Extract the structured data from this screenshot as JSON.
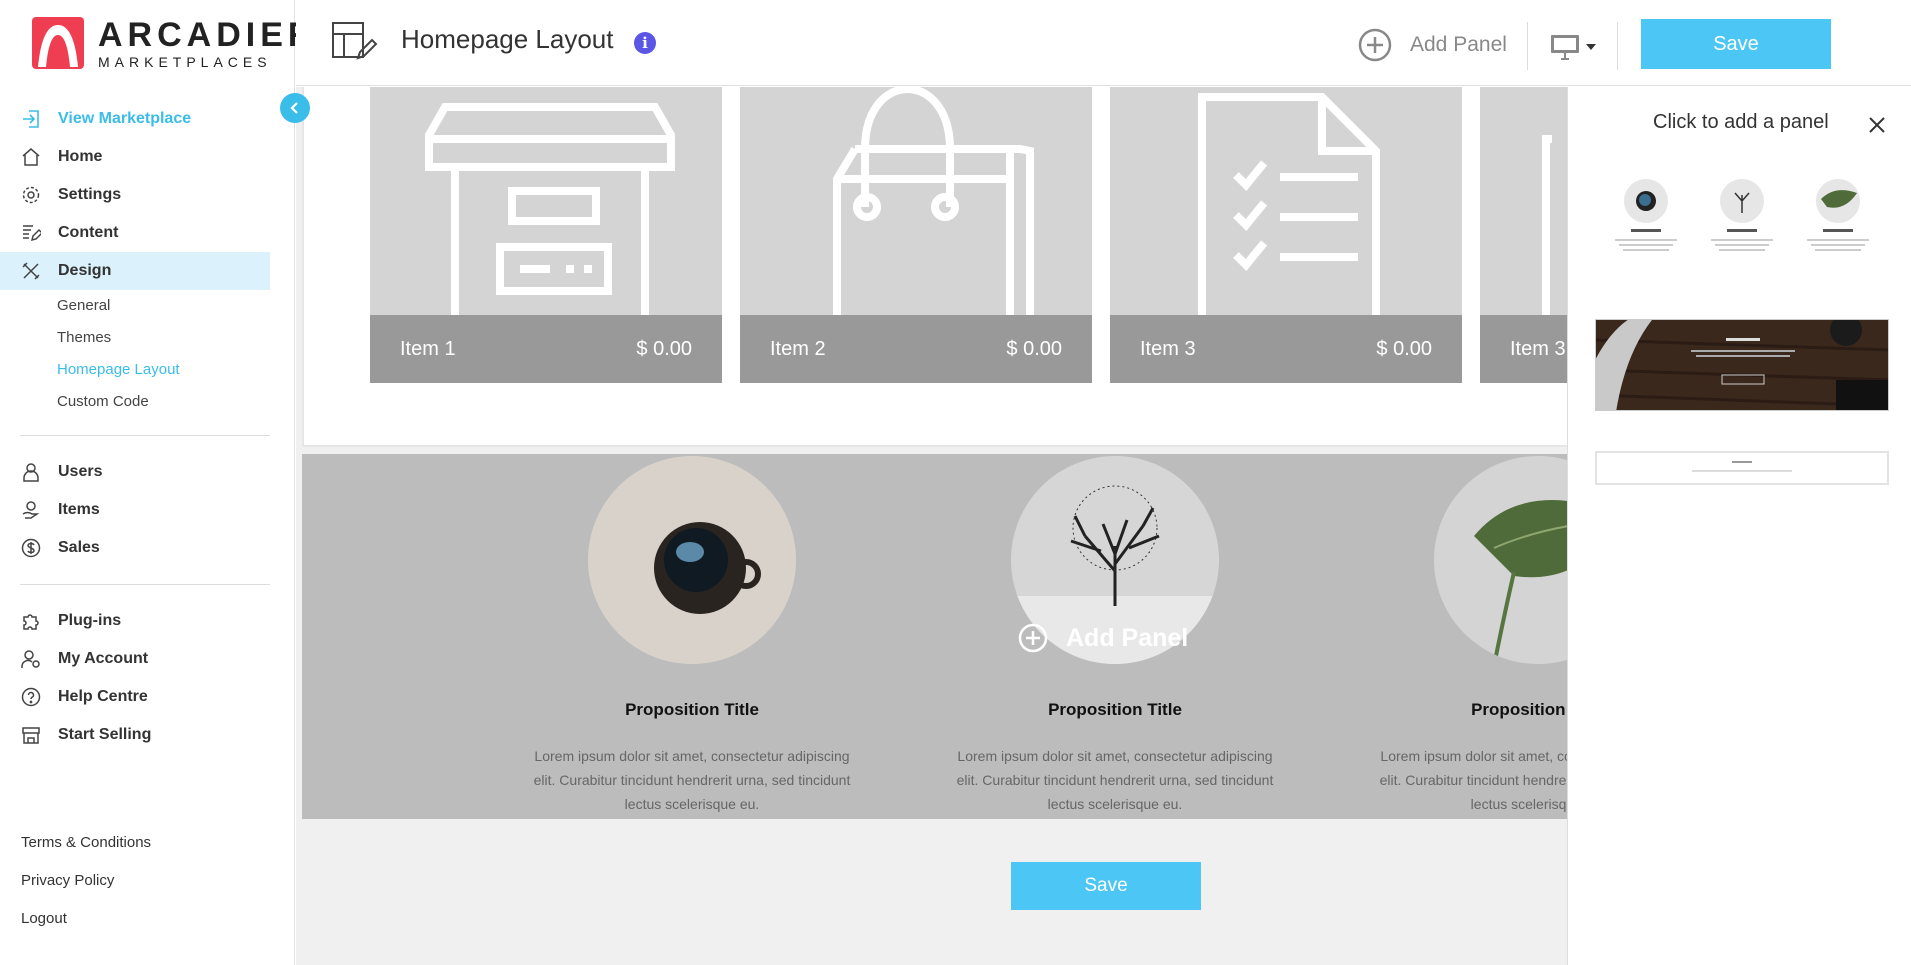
{
  "brand": {
    "line1": "ARCADIER",
    "line2": "MARKETPLACES",
    "color": "#ef3e52"
  },
  "colors": {
    "accent": "#3bbde9",
    "save": "#4cc6f5",
    "info": "#5b56e5"
  },
  "sidebar": {
    "view_marketplace": "View Marketplace",
    "items": [
      {
        "label": "Home",
        "icon": "home-icon"
      },
      {
        "label": "Settings",
        "icon": "gear-icon"
      },
      {
        "label": "Content",
        "icon": "content-edit-icon"
      },
      {
        "label": "Design",
        "icon": "design-tools-icon"
      }
    ],
    "design_sub": [
      "General",
      "Themes",
      "Homepage Layout",
      "Custom Code"
    ],
    "group2": [
      {
        "label": "Users",
        "icon": "user-icon"
      },
      {
        "label": "Items",
        "icon": "items-hand-icon"
      },
      {
        "label": "Sales",
        "icon": "dollar-icon"
      }
    ],
    "group3": [
      {
        "label": "Plug-ins",
        "icon": "puzzle-icon"
      },
      {
        "label": "My Account",
        "icon": "account-gear-icon"
      },
      {
        "label": "Help Centre",
        "icon": "help-icon"
      },
      {
        "label": "Start Selling",
        "icon": "storefront-icon"
      }
    ],
    "footer": [
      "Terms & Conditions",
      "Privacy Policy",
      "Logout"
    ]
  },
  "header": {
    "title": "Homepage Layout",
    "info_glyph": "i",
    "add_panel": "Add Panel",
    "save": "Save"
  },
  "canvas": {
    "items": [
      {
        "name": "Item 1",
        "price": "$ 0.00",
        "icon": "archive-box-icon"
      },
      {
        "name": "Item 2",
        "price": "$ 0.00",
        "icon": "shopping-bag-icon"
      },
      {
        "name": "Item 3",
        "price": "$ 0.00",
        "icon": "checklist-document-icon"
      },
      {
        "name": "Item 3",
        "price": "",
        "icon": "document-icon"
      }
    ],
    "propositions": [
      {
        "title": "Proposition Title",
        "text": "Lorem ipsum dolor sit amet, consectetur adipiscing elit. Curabitur tincidunt hendrerit urna, sed tincidunt lectus scelerisque eu.",
        "image": "coffee-cup"
      },
      {
        "title": "Proposition Title",
        "text": "Lorem ipsum dolor sit amet, consectetur adipiscing elit. Curabitur tincidunt hendrerit urna, sed tincidunt lectus scelerisque eu.",
        "image": "tree"
      },
      {
        "title": "Proposition Title",
        "text": "Lorem ipsum dolor sit amet, consectetur adipiscing elit. Curabitur tincidunt hendrerit urna, sed tincidunt lectus scelerisque eu.",
        "image": "leaf"
      }
    ],
    "add_panel_overlay": "Add Panel",
    "save": "Save"
  },
  "right_panel": {
    "title": "Click to add a panel",
    "thumbs": [
      "proposition-panel-thumb",
      "banner-panel-thumb",
      "title-panel-thumb"
    ]
  }
}
